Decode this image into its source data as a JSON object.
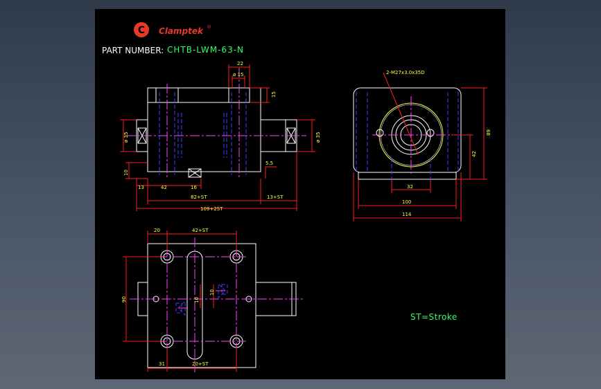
{
  "logo": {
    "mark": "C",
    "name": "Clamptek",
    "registered": "®"
  },
  "part_number": {
    "label": "PART NUMBER:",
    "value": "CHTB-LWM-63-N"
  },
  "legend": {
    "stroke_note": "ST=Stroke"
  },
  "colors": {
    "background": "#000000",
    "outline": "#ffffff",
    "dimension": "#ff2020",
    "dimension_text": "#ffff40",
    "hidden_line": "#4040ff",
    "center_line": "#ff40ff",
    "accent_green": "#33ff66",
    "logo_red": "#e8382a",
    "thread_circle": "#ffff40"
  },
  "front_view": {
    "dims": {
      "top_width": "22",
      "top_dia": "ø 15",
      "top_depth": "15",
      "left_dia": "ø 35",
      "right_dia": "ø 35",
      "left_height": "10",
      "right_offset": "5.5",
      "d13_left": "13",
      "d42": "42",
      "d16": "16",
      "d82st": "82+ST",
      "d13st": "13+ST",
      "d109st": "109+2ST"
    }
  },
  "side_view": {
    "dims": {
      "thread_callout": "2-M27x3.0x35D",
      "height": "89",
      "center_height": "42",
      "d32": "32",
      "d100": "100",
      "d114": "114"
    }
  },
  "top_view": {
    "dims": {
      "d20": "20",
      "d42st": "42+ST",
      "d90": "90",
      "d10a": "10",
      "d10b": "10",
      "d31": "31",
      "d20st": "20+ST"
    }
  }
}
